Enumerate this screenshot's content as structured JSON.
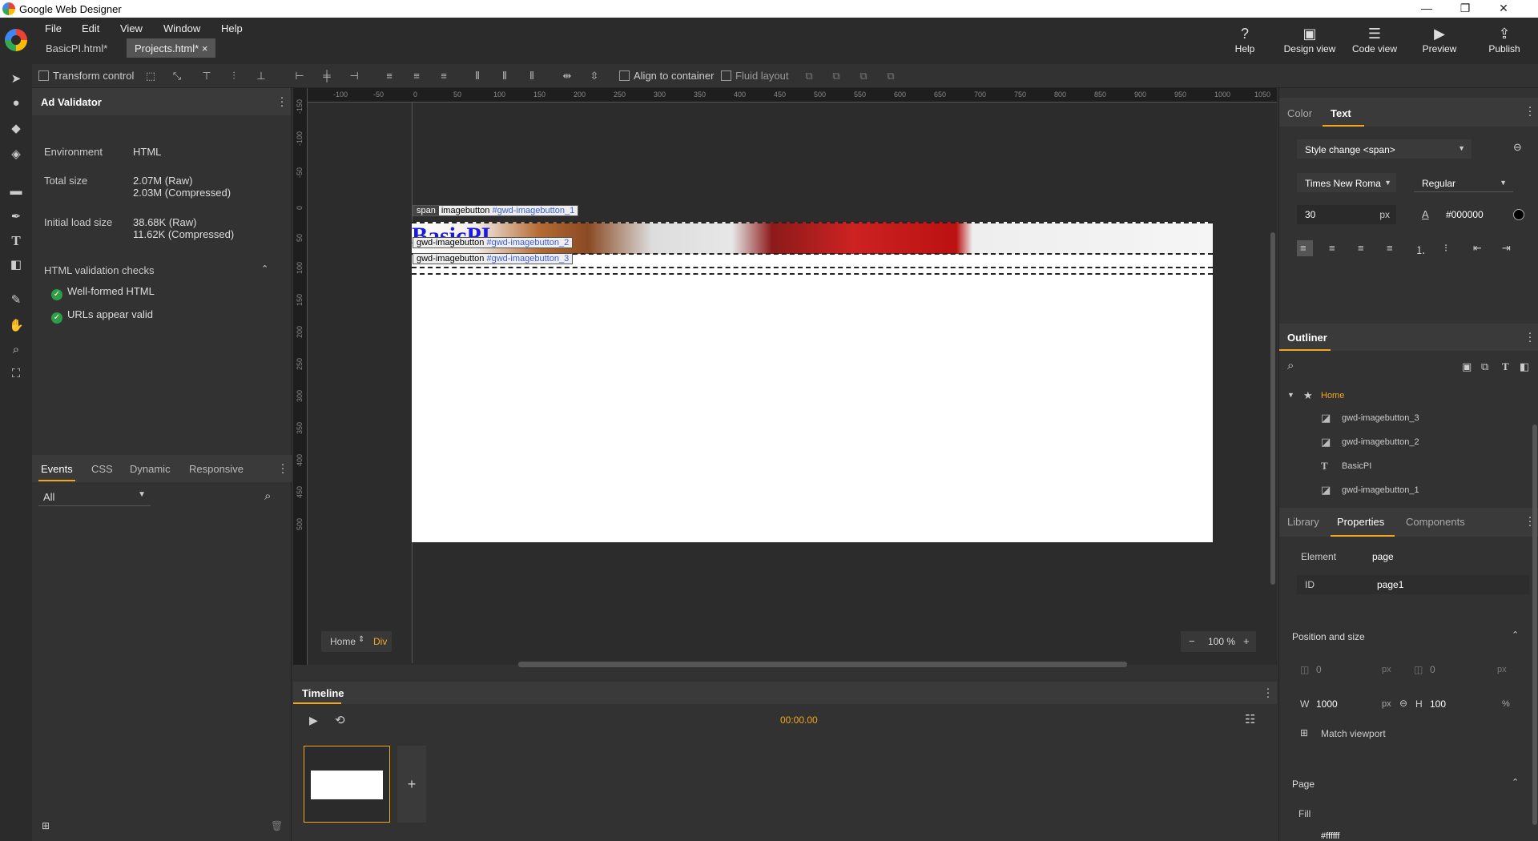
{
  "window": {
    "title": "Google Web Designer"
  },
  "menu": [
    "File",
    "Edit",
    "View",
    "Window",
    "Help"
  ],
  "doc_tabs": [
    {
      "label": "BasicPI.html*"
    },
    {
      "label": "Projects.html*"
    }
  ],
  "doc_tab_close": "×",
  "top_buttons": [
    {
      "label": "Help",
      "icon": "help-icon"
    },
    {
      "label": "Design view",
      "icon": "design-view-icon"
    },
    {
      "label": "Code view",
      "icon": "code-view-icon"
    },
    {
      "label": "Preview",
      "icon": "preview-icon"
    },
    {
      "label": "Publish",
      "icon": "publish-icon"
    }
  ],
  "toolbar": {
    "transform_control": "Transform control",
    "align_to_container": "Align to container",
    "fluid_layout": "Fluid layout"
  },
  "ad_validator": {
    "title": "Ad Validator",
    "rows": [
      {
        "key": "Environment",
        "value": "HTML"
      },
      {
        "key": "Total size",
        "value": "2.07M (Raw)",
        "value2": "2.03M (Compressed)"
      },
      {
        "key": "Initial load size",
        "value": "38.68K (Raw)",
        "value2": "11.62K (Compressed)"
      }
    ],
    "checks_title": "HTML validation checks",
    "checks": [
      "Well-formed HTML",
      "URLs appear valid"
    ]
  },
  "events_panel": {
    "tabs": [
      "Events",
      "CSS",
      "Dynamic",
      "Responsive"
    ],
    "filter": "All"
  },
  "canvas": {
    "ruler_top": [
      "-100",
      "-50",
      "0",
      "50",
      "100",
      "150",
      "200",
      "250",
      "300",
      "350",
      "400",
      "450",
      "500",
      "550",
      "600",
      "650",
      "700",
      "750",
      "800",
      "850",
      "900",
      "950",
      "1000",
      "1050"
    ],
    "ruler_left": [
      "-150",
      "-100",
      "-50",
      "0",
      "50",
      "100",
      "150",
      "200",
      "250",
      "300",
      "350",
      "400",
      "450",
      "500"
    ],
    "heading": "BasicPI",
    "labels": [
      {
        "tag": "span",
        "text": "imagebutton ",
        "id": "#gwd-imagebutton_1"
      },
      {
        "tag": "",
        "text": "gwd-imagebutton ",
        "id": "#gwd-imagebutton_2"
      },
      {
        "tag": "",
        "text": "gwd-imagebutton ",
        "id": "#gwd-imagebutton_3"
      }
    ],
    "breadcrumb": {
      "page": "Home",
      "element": "Div"
    },
    "zoom": "100 %"
  },
  "timeline": {
    "title": "Timeline",
    "time": "00:00.00"
  },
  "text_panel": {
    "tabs": [
      "Color",
      "Text"
    ],
    "style": "Style change <span>",
    "font": "Times New Roma",
    "weight": "Regular",
    "size": "30",
    "unit": "px",
    "color": "#000000"
  },
  "outliner": {
    "title": "Outliner",
    "items": [
      "Home",
      "gwd-imagebutton_3",
      "gwd-imagebutton_2",
      "BasicPI",
      "gwd-imagebutton_1"
    ]
  },
  "properties": {
    "tabs": [
      "Library",
      "Properties",
      "Components"
    ],
    "element_label": "Element",
    "element_value": "page",
    "id_label": "ID",
    "id_value": "page1",
    "position_title": "Position and size",
    "x": "0",
    "y": "0",
    "unit": "px",
    "w_label": "W",
    "w": "1000",
    "h_label": "H",
    "h": "100",
    "h_unit": "%",
    "match_viewport": "Match viewport",
    "page_title": "Page",
    "fill_label": "Fill",
    "fill_value": "#ffffff"
  }
}
